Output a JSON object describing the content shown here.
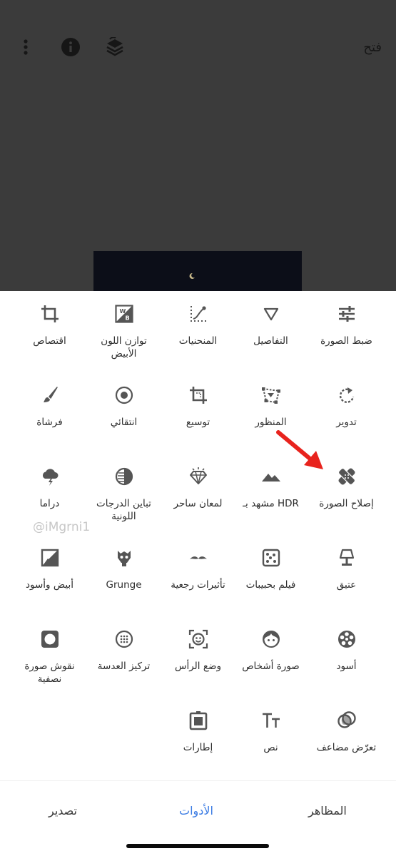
{
  "toolbar": {
    "open_label": "فتح",
    "icons": [
      "more-vert-icon",
      "info-icon",
      "layers-undo-icon"
    ]
  },
  "watermark": "@iMgrni1",
  "tools": [
    {
      "label": "ضبط الصورة",
      "icon": "tune-icon"
    },
    {
      "label": "التفاصيل",
      "icon": "details-icon"
    },
    {
      "label": "المنحنيات",
      "icon": "curves-icon"
    },
    {
      "label": "توازن اللون الأبيض",
      "icon": "white-balance-icon"
    },
    {
      "label": "اقتصاص",
      "icon": "crop-icon"
    },
    {
      "label": "تدوير",
      "icon": "rotate-icon"
    },
    {
      "label": "المنظور",
      "icon": "perspective-icon"
    },
    {
      "label": "توسيع",
      "icon": "expand-icon"
    },
    {
      "label": "انتقائي",
      "icon": "selective-icon"
    },
    {
      "label": "فرشاة",
      "icon": "brush-icon"
    },
    {
      "label": "إصلاح الصورة",
      "icon": "healing-icon"
    },
    {
      "label": "مشهد بـ HDR",
      "icon": "hdr-icon"
    },
    {
      "label": "لمعان ساحر",
      "icon": "glamour-glow-icon"
    },
    {
      "label": "تباين الدرجات اللونية",
      "icon": "tonal-contrast-icon"
    },
    {
      "label": "دراما",
      "icon": "drama-icon"
    },
    {
      "label": "عتيق",
      "icon": "vintage-icon"
    },
    {
      "label": "فيلم بحبيبات",
      "icon": "grainy-film-icon"
    },
    {
      "label": "تأثيرات رجعية",
      "icon": "retrolux-icon"
    },
    {
      "label": "Grunge",
      "icon": "grunge-icon"
    },
    {
      "label": "أبيض وأسود",
      "icon": "black-white-icon"
    },
    {
      "label": "أسود",
      "icon": "noir-icon"
    },
    {
      "label": "صورة أشخاص",
      "icon": "portrait-icon"
    },
    {
      "label": "وضع الرأس",
      "icon": "head-pose-icon"
    },
    {
      "label": "تركيز العدسة",
      "icon": "lens-blur-icon"
    },
    {
      "label": "نقوش صورة نصفية",
      "icon": "vignette-icon"
    },
    {
      "label": "تعرّض مضاعف",
      "icon": "double-exposure-icon"
    },
    {
      "label": "نص",
      "icon": "text-icon"
    },
    {
      "label": "إطارات",
      "icon": "frames-icon"
    }
  ],
  "tabs": {
    "looks": "المظاهر",
    "tools": "الأدوات",
    "export": "تصدير"
  },
  "colors": {
    "accent": "#3d7de4",
    "icon": "#555555",
    "annotation_arrow": "#e8231d"
  }
}
